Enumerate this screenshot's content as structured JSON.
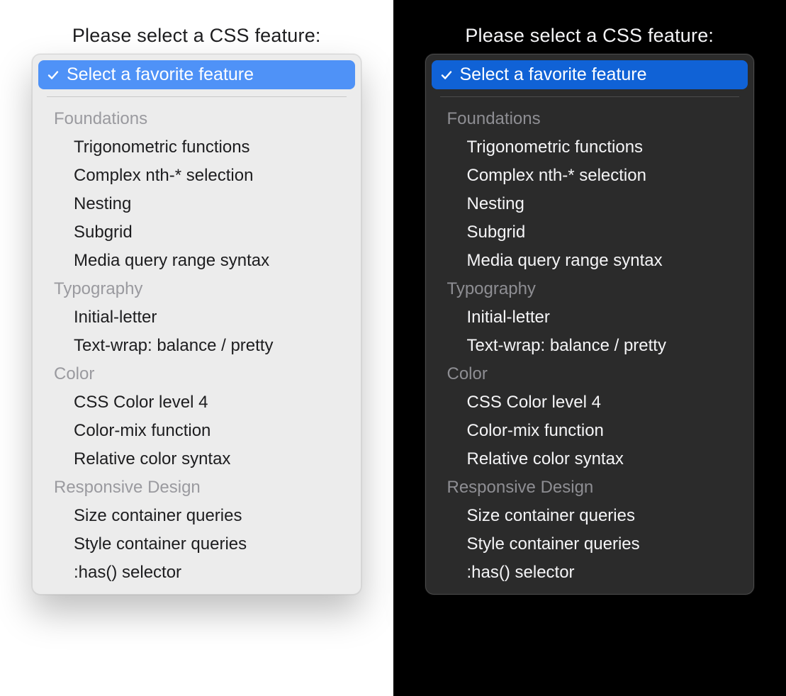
{
  "prompt": "Please select a CSS feature:",
  "selected_label": "Select a favorite feature",
  "colors": {
    "light_accent": "#4f92f7",
    "dark_accent": "#1062d6"
  },
  "groups": [
    {
      "label": "Foundations",
      "options": [
        "Trigonometric functions",
        "Complex nth-* selection",
        "Nesting",
        "Subgrid",
        "Media query range syntax"
      ]
    },
    {
      "label": "Typography",
      "options": [
        "Initial-letter",
        "Text-wrap: balance / pretty"
      ]
    },
    {
      "label": "Color",
      "options": [
        "CSS Color level 4",
        "Color-mix function",
        "Relative color syntax"
      ]
    },
    {
      "label": "Responsive Design",
      "options": [
        "Size container queries",
        "Style container queries",
        ":has() selector"
      ]
    }
  ]
}
